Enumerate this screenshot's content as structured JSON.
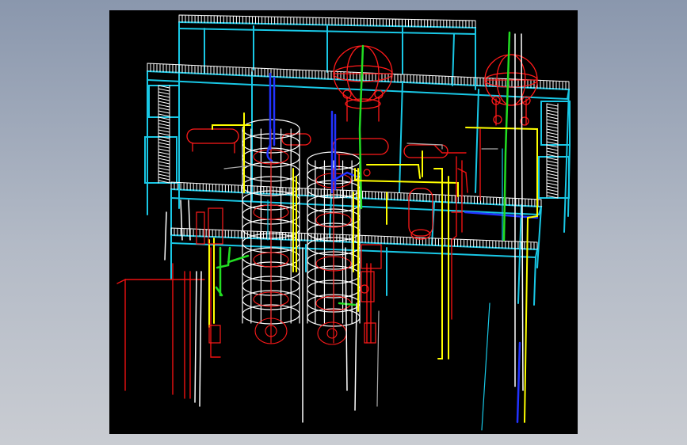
{
  "window": {
    "title": ""
  },
  "viewport": {
    "background": "#000000",
    "content": "cad-wireframe-plant",
    "colors": {
      "frame": "#19c8e6",
      "railing": "#ffffff",
      "tower": "#ffffff",
      "vessel": "#ff1a1a",
      "pipe_yellow": "#ffff00",
      "pipe_green": "#22dd22",
      "pipe_blue": "#2233ff",
      "pipe_red": "#ee1111",
      "pipe_white": "#ffffff",
      "pipe_grey": "#aaaaaa"
    }
  }
}
